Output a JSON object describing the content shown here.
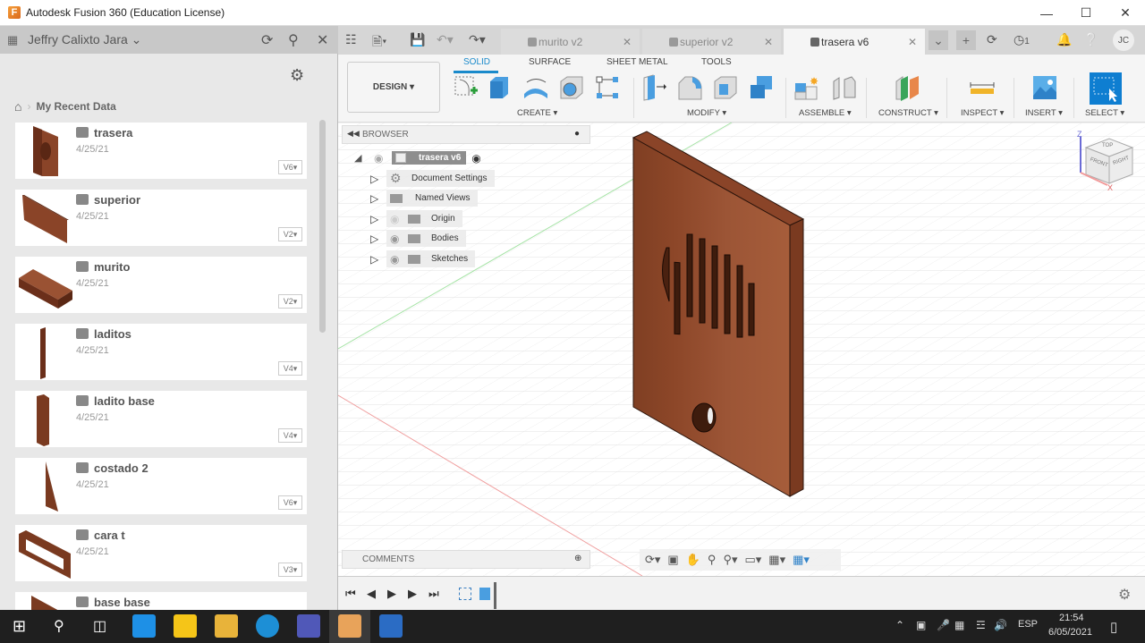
{
  "window": {
    "title": "Autodesk Fusion 360 (Education License)",
    "app_icon_letter": "F",
    "controls": {
      "minimize": "—",
      "maximize": "☐",
      "close": "✕"
    }
  },
  "data_panel": {
    "user": "Jeffry Calixto Jara",
    "breadcrumb": "My Recent Data",
    "items": [
      {
        "name": "trasera",
        "date": "4/25/21",
        "version": "V6▾"
      },
      {
        "name": "superior",
        "date": "4/25/21",
        "version": "V2▾"
      },
      {
        "name": "murito",
        "date": "4/25/21",
        "version": "V2▾"
      },
      {
        "name": "laditos",
        "date": "4/25/21",
        "version": "V4▾"
      },
      {
        "name": "ladito base",
        "date": "4/25/21",
        "version": "V4▾"
      },
      {
        "name": "costado 2",
        "date": "4/25/21",
        "version": "V6▾"
      },
      {
        "name": "cara t",
        "date": "4/25/21",
        "version": "V3▾"
      },
      {
        "name": "base base",
        "date": "",
        "version": ""
      }
    ]
  },
  "tabs": [
    {
      "label": "murito v2",
      "active": false
    },
    {
      "label": "superior v2",
      "active": false
    },
    {
      "label": "trasera v6",
      "active": true
    }
  ],
  "header_right": {
    "jobs_count": "1",
    "user_initials": "JC"
  },
  "toolbar": {
    "workspace": "DESIGN ▾",
    "workspace_tabs": [
      "SOLID",
      "SURFACE",
      "SHEET METAL",
      "TOOLS"
    ],
    "active_tab": "SOLID",
    "groups": [
      "CREATE ▾",
      "MODIFY ▾",
      "ASSEMBLE ▾",
      "CONSTRUCT ▾",
      "INSPECT ▾",
      "INSERT ▾",
      "SELECT ▾"
    ]
  },
  "browser": {
    "title": "BROWSER",
    "root": "trasera v6",
    "nodes": [
      "Document Settings",
      "Named Views",
      "Origin",
      "Bodies",
      "Sketches"
    ]
  },
  "comments": {
    "title": "COMMENTS"
  },
  "viewcube": {
    "top": "TOP",
    "front": "FRONT",
    "right": "RIGHT",
    "axis_z": "Z",
    "axis_x": "X"
  },
  "taskbar": {
    "language": "ESP",
    "time": "21:54",
    "date": "6/05/2021"
  },
  "colors": {
    "accent": "#1a8acb",
    "wood": "#9a5233"
  }
}
